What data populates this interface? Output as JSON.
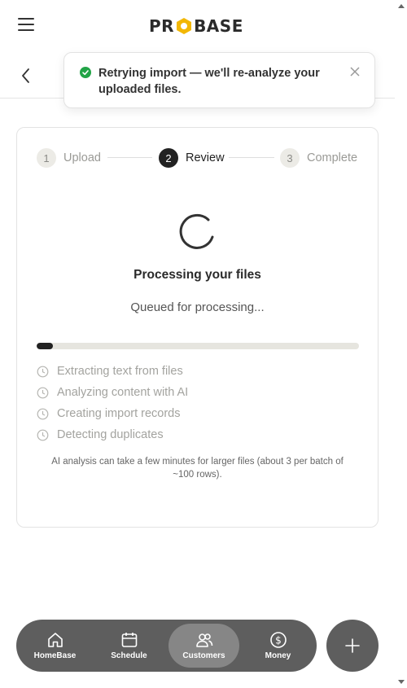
{
  "header": {
    "logo_text": "PROBASE",
    "logo_accent_color": "#f2b705"
  },
  "toast": {
    "message": "Retrying import — we'll re-analyze your uploaded files.",
    "status_color": "#22a447"
  },
  "stepper": {
    "steps": [
      {
        "number": "1",
        "label": "Upload",
        "state": "inactive"
      },
      {
        "number": "2",
        "label": "Review",
        "state": "active"
      },
      {
        "number": "3",
        "label": "Complete",
        "state": "inactive"
      }
    ]
  },
  "processing": {
    "title": "Processing your files",
    "status": "Queued for processing...",
    "progress_percent": 5,
    "tasks": [
      {
        "label": "Extracting text from files",
        "icon": "clock-icon"
      },
      {
        "label": "Analyzing content with AI",
        "icon": "clock-icon"
      },
      {
        "label": "Creating import records",
        "icon": "clock-icon"
      },
      {
        "label": "Detecting duplicates",
        "icon": "clock-icon"
      }
    ],
    "note": "AI analysis can take a few minutes for larger files (about 3 per batch of ~100 rows)."
  },
  "bottom_nav": {
    "items": [
      {
        "label": "HomeBase",
        "icon": "home-icon",
        "active": false
      },
      {
        "label": "Schedule",
        "icon": "calendar-icon",
        "active": false
      },
      {
        "label": "Customers",
        "icon": "users-icon",
        "active": true
      },
      {
        "label": "Money",
        "icon": "dollar-icon",
        "active": false
      }
    ],
    "fab_icon": "plus-icon"
  }
}
